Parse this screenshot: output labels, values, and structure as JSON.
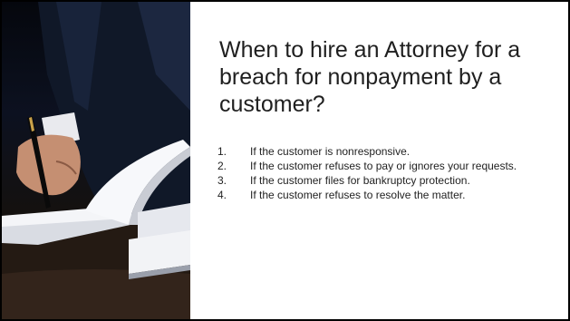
{
  "slide": {
    "title": "When to hire an Attorney for a breach for nonpayment by a customer?",
    "items": [
      {
        "number": "1.",
        "text": "If the customer is nonresponsive."
      },
      {
        "number": "2.",
        "text": "If the customer refuses to pay or ignores your requests."
      },
      {
        "number": "3.",
        "text": "If the customer files for bankruptcy protection."
      },
      {
        "number": "4.",
        "text": "If the customer refuses to resolve the matter."
      }
    ]
  },
  "photo": {
    "subject": "attorney-signing-documents-image"
  }
}
